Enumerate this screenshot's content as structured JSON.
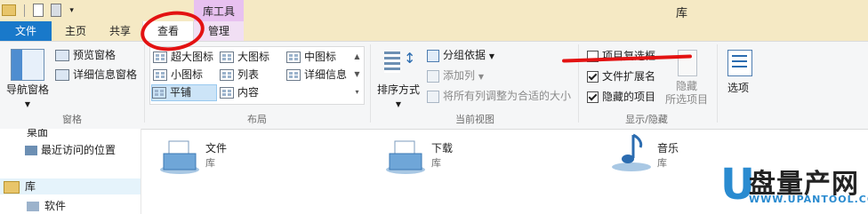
{
  "titlebar": {
    "contextual_group": "库工具",
    "window_title": "库"
  },
  "tabs": {
    "file": "文件",
    "home": "主页",
    "share": "共享",
    "view": "查看",
    "manage": "管理"
  },
  "ribbon": {
    "panes": {
      "nav_pane": "导航窗格",
      "preview_pane": "预览窗格",
      "details_pane": "详细信息窗格",
      "group_label": "窗格"
    },
    "layout": {
      "extra_large_icons": "超大图标",
      "large_icons": "大图标",
      "medium_icons": "中图标",
      "small_icons": "小图标",
      "list": "列表",
      "details": "详细信息",
      "tiles": "平铺",
      "content": "内容",
      "group_label": "布局",
      "selected": "平铺"
    },
    "current_view": {
      "sort_by": "排序方式",
      "group_by": "分组依据",
      "add_columns": "添加列",
      "size_all_columns": "将所有列调整为合适的大小",
      "group_label": "当前视图"
    },
    "show_hide": {
      "item_checkboxes": "项目复选框",
      "item_checkboxes_checked": false,
      "file_extensions": "文件扩展名",
      "file_extensions_checked": true,
      "hidden_items": "隐藏的项目",
      "hidden_items_checked": true,
      "hide_selected_line1": "隐藏",
      "hide_selected_line2": "所选项目",
      "group_label": "显示/隐藏"
    },
    "options": "选项"
  },
  "navpane": {
    "items": [
      "桌面",
      "最近访问的位置",
      "库",
      "软件"
    ]
  },
  "libraries": [
    {
      "name": "文件",
      "sub": "库"
    },
    {
      "name": "下载",
      "sub": "库"
    },
    {
      "name": "音乐",
      "sub": "库"
    }
  ],
  "watermark": {
    "brand_cn": "盘量产网",
    "brand_en": "WWW.UPANTOOL.COM"
  },
  "colors": {
    "file_tab": "#1979ca",
    "titlebar": "#f5e9c4",
    "contextual": "#e8c1f0",
    "annotation": "#e31212"
  }
}
